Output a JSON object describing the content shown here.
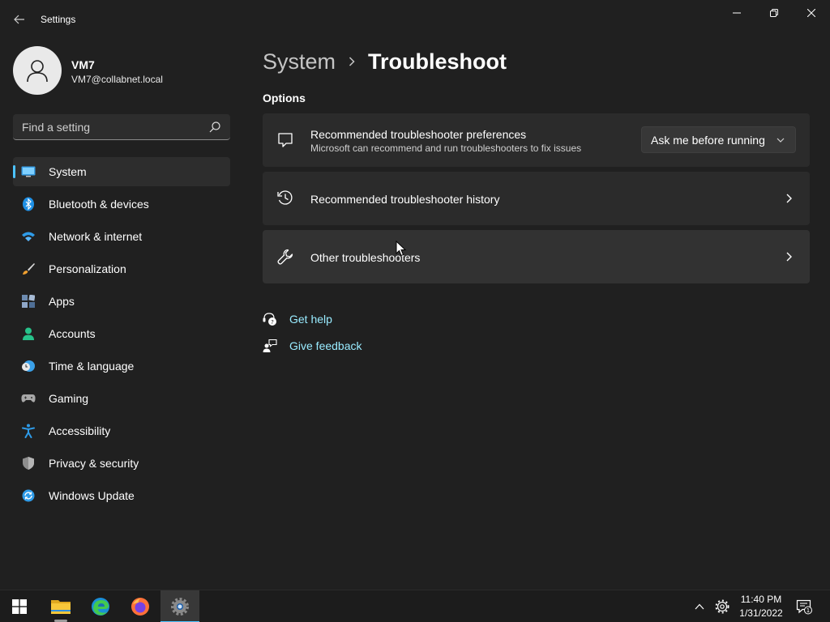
{
  "window": {
    "app_title": "Settings",
    "back_icon": "back-arrow-icon",
    "controls": [
      "minimize-icon",
      "restore-icon",
      "close-icon"
    ]
  },
  "account": {
    "name": "VM7",
    "email": "VM7@collabnet.local"
  },
  "search": {
    "placeholder": "Find a setting",
    "value": ""
  },
  "nav": {
    "items": [
      {
        "label": "System",
        "icon": "system-icon",
        "selected": true
      },
      {
        "label": "Bluetooth & devices",
        "icon": "bluetooth-icon"
      },
      {
        "label": "Network & internet",
        "icon": "wifi-icon"
      },
      {
        "label": "Personalization",
        "icon": "brush-icon"
      },
      {
        "label": "Apps",
        "icon": "apps-icon"
      },
      {
        "label": "Accounts",
        "icon": "person-icon"
      },
      {
        "label": "Time & language",
        "icon": "clock-globe-icon"
      },
      {
        "label": "Gaming",
        "icon": "gamepad-icon"
      },
      {
        "label": "Accessibility",
        "icon": "accessibility-icon"
      },
      {
        "label": "Privacy & security",
        "icon": "shield-icon"
      },
      {
        "label": "Windows Update",
        "icon": "update-icon"
      }
    ]
  },
  "main": {
    "breadcrumb_parent": "System",
    "breadcrumb_current": "Troubleshoot",
    "section_title": "Options",
    "cards": [
      {
        "title": "Recommended troubleshooter preferences",
        "subtitle": "Microsoft can recommend and run troubleshooters to fix issues",
        "icon": "chat-bubble-icon",
        "dropdown_value": "Ask me before running"
      },
      {
        "title": "Recommended troubleshooter history",
        "icon": "history-icon"
      },
      {
        "title": "Other troubleshooters",
        "icon": "wrench-icon"
      }
    ],
    "links": [
      {
        "label": "Get help",
        "icon": "help-icon"
      },
      {
        "label": "Give feedback",
        "icon": "feedback-icon"
      }
    ]
  },
  "taskbar": {
    "apps": [
      "start-icon",
      "file-explorer-icon",
      "edge-icon",
      "firefox-icon",
      "settings-icon"
    ],
    "clock_time": "11:40 PM",
    "clock_date": "1/31/2022",
    "notification_count": "1"
  },
  "colors": {
    "background": "#202020",
    "card": "#2b2b2b",
    "accent": "#4cc2ff",
    "link": "#99ebff"
  }
}
